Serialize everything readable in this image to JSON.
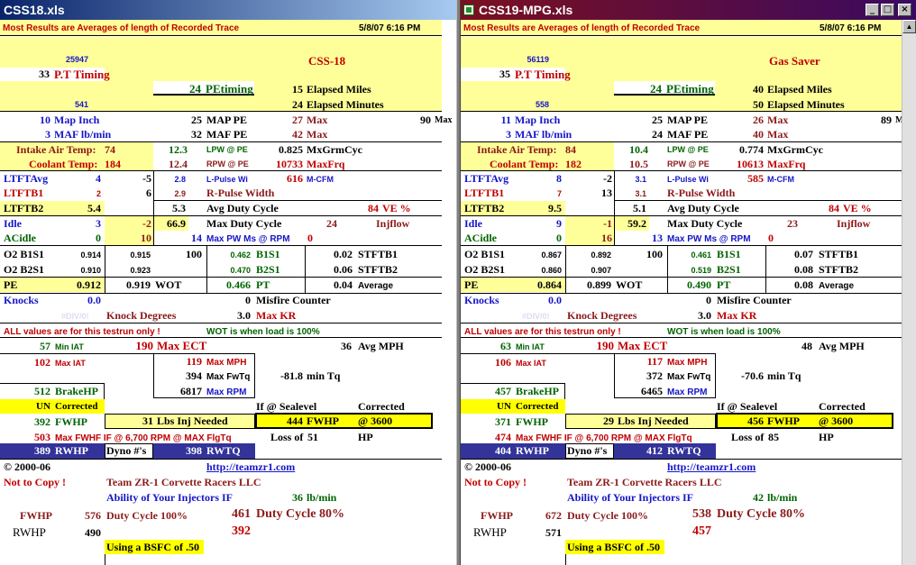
{
  "left": {
    "title": "CSS18.xls",
    "header": {
      "note": "Most Results are Averages of length of Recorded Trace",
      "date": "5/8/07 6:16 PM"
    },
    "top": {
      "v1": "25947",
      "pt_val": "33",
      "pt_label": "P.T Timing",
      "car_name": "CSS-18",
      "v2": "541",
      "petiming_val": "24",
      "petiming_label": "PEtiming",
      "miles_val": "15",
      "miles_label": "Elapsed Miles",
      "minutes_val": "24",
      "minutes_label": "Elapsed Minutes"
    },
    "map": {
      "map_inch_val": "10",
      "map_inch_label": "Map Inch",
      "map_pe_val": "25",
      "map_pe_label": "MAP PE",
      "max1_val": "27",
      "max1_label": "Max",
      "max_extra_val": "90",
      "max_extra_label": "Max",
      "maf_val": "3",
      "maf_label": "MAF lb/min",
      "maf_pe_val": "32",
      "maf_pe_label": "MAF PE",
      "max2_val": "42",
      "max2_label": "Max"
    },
    "temps": {
      "iat_label": "Intake Air Temp:",
      "iat_val": "74",
      "lpw_val": "12.3",
      "lpw_label": "LPW @ PE",
      "mxgrm_val": "0.825",
      "mxgrm_label": "MxGrmCyc",
      "ct_label": "Coolant Temp:",
      "ct_val": "184",
      "rpw_val": "12.4",
      "rpw_label": "RPW @ PE",
      "maxfrq_val": "10733",
      "maxfrq_label": "MaxFrq"
    },
    "fuel": {
      "ltftavg_label": "LTFTAvg",
      "ltftavg_v1": "4",
      "ltftavg_v2": "-5",
      "lpulse_val": "2.8",
      "lpulse_label": "L-Pulse Wi",
      "mcfm_val": "616",
      "mcfm_label": "M-CFM",
      "ltftb1_label": "LTFTB1",
      "ltftb1_v1": "2",
      "ltftb1_v2": "6",
      "rpulse_val": "2.9",
      "rpulse_label": "R-Pulse Width",
      "ltftb2_label": "LTFTB2",
      "ltftb2_val": "5.4",
      "avgdc_val": "5.3",
      "avgdc_label": "Avg Duty Cycle",
      "ve_val": "84",
      "ve_label": "VE %",
      "idle_label": "Idle",
      "idle_v1": "3",
      "idle_v2": "-2",
      "maxdc_val": "66.9",
      "maxdc_label": "Max Duty Cycle",
      "injflow_val": "24",
      "injflow_label": "Injflow",
      "acidle_label": "ACidle",
      "acidle_v1": "0",
      "acidle_v2": "10",
      "maxpw_val": "14",
      "maxpw_label": "Max PW Ms @ RPM",
      "maxpw_rpm": "0"
    },
    "o2": {
      "b1_label": "O2 B1S1",
      "b1_v1": "0.914",
      "b1_v2": "0.915",
      "b1_v3": "100",
      "b1_v4": "0.462",
      "b1_mid": "B1S1",
      "b1_v5": "0.02",
      "b1_right": "STFTB1",
      "b2_label": "O2 B2S1",
      "b2_v1": "0.910",
      "b2_v2": "0.923",
      "b2_v4": "0.470",
      "b2_mid": "B2S1",
      "b2_v5": "0.06",
      "b2_right": "STFTB2",
      "pe_label": "PE",
      "pe_val": "0.912",
      "wot_val": "0.919",
      "wot_label": "WOT",
      "pt_val": "0.466",
      "pt_label": "PT",
      "avg_val": "0.04",
      "avg_label": "Average"
    },
    "knock": {
      "knocks_label": "Knocks",
      "knocks_val": "0.0",
      "misfire_val": "0",
      "misfire_label": "Misfire Counter",
      "div0": "#DIV/0!",
      "kd_label": "Knock Degrees",
      "maxkr_val": "3.0",
      "maxkr_label": "Max KR"
    },
    "notes": {
      "all_values": "ALL values are for this testrun only !",
      "wot_note": "WOT is when load is 100%"
    },
    "perf": {
      "miniat_val": "57",
      "miniat_label": "Min IAT",
      "maxect_val": "190",
      "maxect_label": "Max ECT",
      "avgmph_val": "36",
      "avgmph_label": "Avg MPH",
      "maxiat_val": "102",
      "maxiat_label": "Max IAT",
      "maxmph_val": "119",
      "maxmph_label": "Max MPH",
      "maxfwtq_val": "394",
      "maxfwtq_label": "Max FwTq",
      "mintq_val": "-81.8",
      "mintq_label": "min Tq",
      "maxrpm_val": "6817",
      "maxrpm_label": "Max RPM"
    },
    "hp": {
      "brake_val": "512",
      "brake_label": "BrakeHP",
      "un_label": "UN",
      "corrected_label": "Corrected",
      "if_sealevel": "If @ Sealevel",
      "corrected2": "Corrected",
      "fwhp_val": "392",
      "fwhp_label": "FWHP",
      "lbs_val": "31",
      "lbs_label": "Lbs Inj Needed",
      "fwhp2_val": "444",
      "fwhp2_label": "FWHP",
      "at3600": "@ 3600",
      "maxfwhf_val": "503",
      "maxfwhf_label": "Max FWHF IF @ 6,700 RPM @ MAX FlgTq",
      "loss_label": "Loss of",
      "loss_val": "51",
      "hp_label": "HP",
      "rwhp_val": "389",
      "rwhp_label": "RWHP",
      "dyno_label": "Dyno #'s",
      "rwtq_val": "398",
      "rwtq_label": "RWTQ"
    },
    "footer": {
      "copyright": "© 2000-06",
      "url": "http://teamzr1.com",
      "notcopy": "Not to Copy !",
      "team": "Team ZR-1 Corvette Racers LLC",
      "ability": "Ability of Your Injectors IF",
      "inj_val": "36",
      "inj_unit": "lb/min",
      "fwhp_label": "FWHP",
      "dc100_val": "576",
      "dc100_label": "Duty Cycle 100%",
      "dc80_val": "461",
      "dc80_label": "Duty Cycle 80%",
      "rwhp_label": "RWHP",
      "rwhp100": "490",
      "rwhp80": "392",
      "bsfc": "Using a BSFC of .50"
    }
  },
  "right": {
    "title": "CSS19-MPG.xls",
    "window_buttons": {
      "minimize": "_",
      "maximize": "□",
      "close": "×"
    },
    "header": {
      "note": "Most Results are Averages of length of Recorded Trace",
      "date": "5/8/07 6:16 PM"
    },
    "top": {
      "v1": "56119",
      "pt_val": "35",
      "pt_label": "P.T Timing",
      "car_name": "Gas Saver",
      "v2": "558",
      "petiming_val": "24",
      "petiming_label": "PEtiming",
      "miles_val": "40",
      "miles_label": "Elapsed Miles",
      "minutes_val": "50",
      "minutes_label": "Elapsed Minutes"
    },
    "map": {
      "map_inch_val": "11",
      "map_inch_label": "Map Inch",
      "map_pe_val": "25",
      "map_pe_label": "MAP PE",
      "max1_val": "26",
      "max1_label": "Max",
      "max_extra_val": "89",
      "max_extra_label": "M",
      "maf_val": "3",
      "maf_label": "MAF lb/min",
      "maf_pe_val": "24",
      "maf_pe_label": "MAF PE",
      "max2_val": "40",
      "max2_label": "Max"
    },
    "temps": {
      "iat_label": "Intake Air Temp:",
      "iat_val": "84",
      "lpw_val": "10.4",
      "lpw_label": "LPW @ PE",
      "mxgrm_val": "0.774",
      "mxgrm_label": "MxGrmCyc",
      "ct_label": "Coolant Temp:",
      "ct_val": "182",
      "rpw_val": "10.5",
      "rpw_label": "RPW @ PE",
      "maxfrq_val": "10613",
      "maxfrq_label": "MaxFrq"
    },
    "fuel": {
      "ltftavg_label": "LTFTAvg",
      "ltftavg_v1": "8",
      "ltftavg_v2": "-2",
      "lpulse_val": "3.1",
      "lpulse_label": "L-Pulse Wi",
      "mcfm_val": "585",
      "mcfm_label": "M-CFM",
      "ltftb1_label": "LTFTB1",
      "ltftb1_v1": "7",
      "ltftb1_v2": "13",
      "rpulse_val": "3.1",
      "rpulse_label": "R-Pulse Width",
      "ltftb2_label": "LTFTB2",
      "ltftb2_val": "9.5",
      "avgdc_val": "5.1",
      "avgdc_label": "Avg Duty Cycle",
      "ve_val": "84",
      "ve_label": "VE %",
      "idle_label": "Idle",
      "idle_v1": "9",
      "idle_v2": "-1",
      "maxdc_val": "59.2",
      "maxdc_label": "Max Duty Cycle",
      "injflow_val": "23",
      "injflow_label": "Injflow",
      "acidle_label": "ACidle",
      "acidle_v1": "0",
      "acidle_v2": "16",
      "maxpw_val": "13",
      "maxpw_label": "Max PW Ms @ RPM",
      "maxpw_rpm": "0"
    },
    "o2": {
      "b1_label": "O2 B1S1",
      "b1_v1": "0.867",
      "b1_v2": "0.892",
      "b1_v3": "100",
      "b1_v4": "0.461",
      "b1_mid": "B1S1",
      "b1_v5": "0.07",
      "b1_right": "STFTB1",
      "b2_label": "O2 B2S1",
      "b2_v1": "0.860",
      "b2_v2": "0.907",
      "b2_v4": "0.519",
      "b2_mid": "B2S1",
      "b2_v5": "0.08",
      "b2_right": "STFTB2",
      "pe_label": "PE",
      "pe_val": "0.864",
      "wot_val": "0.899",
      "wot_label": "WOT",
      "pt_val": "0.490",
      "pt_label": "PT",
      "avg_val": "0.08",
      "avg_label": "Average"
    },
    "knock": {
      "knocks_label": "Knocks",
      "knocks_val": "0.0",
      "misfire_val": "0",
      "misfire_label": "Misfire Counter",
      "div0": "#DIV/0!",
      "kd_label": "Knock Degrees",
      "maxkr_val": "3.0",
      "maxkr_label": "Max KR"
    },
    "notes": {
      "all_values": "ALL values are for this testrun only !",
      "wot_note": "WOT is when load is 100%"
    },
    "perf": {
      "miniat_val": "63",
      "miniat_label": "Min IAT",
      "maxect_val": "190",
      "maxect_label": "Max ECT",
      "avgmph_val": "48",
      "avgmph_label": "Avg MPH",
      "maxiat_val": "106",
      "maxiat_label": "Max IAT",
      "maxmph_val": "117",
      "maxmph_label": "Max MPH",
      "maxfwtq_val": "372",
      "maxfwtq_label": "Max FwTq",
      "mintq_val": "-70.6",
      "mintq_label": "min Tq",
      "maxrpm_val": "6465",
      "maxrpm_label": "Max RPM"
    },
    "hp": {
      "brake_val": "457",
      "brake_label": "BrakeHP",
      "un_label": "UN",
      "corrected_label": "Corrected",
      "if_sealevel": "If @ Sealevel",
      "corrected2": "Corrected",
      "fwhp_val": "371",
      "fwhp_label": "FWHP",
      "lbs_val": "29",
      "lbs_label": "Lbs Inj Needed",
      "fwhp2_val": "456",
      "fwhp2_label": "FWHP",
      "at3600": "@ 3600",
      "maxfwhf_val": "474",
      "maxfwhf_label": "Max FWHF IF @ 6,700 RPM @ MAX FlgTq",
      "loss_label": "Loss of",
      "loss_val": "85",
      "hp_label": "HP",
      "rwhp_val": "404",
      "rwhp_label": "RWHP",
      "dyno_label": "Dyno #'s",
      "rwtq_val": "412",
      "rwtq_label": "RWTQ"
    },
    "footer": {
      "copyright": "© 2000-06",
      "url": "http://teamzr1.com",
      "notcopy": "Not to Copy !",
      "team": "Team ZR-1 Corvette Racers LLC",
      "ability": "Ability of Your Injectors IF",
      "inj_val": "42",
      "inj_unit": "lb/min",
      "fwhp_label": "FWHP",
      "dc100_val": "672",
      "dc100_label": "Duty Cycle 100%",
      "dc80_val": "538",
      "dc80_label": "Duty Cycle 80%",
      "rwhp_label": "RWHP",
      "rwhp100": "571",
      "rwhp80": "457",
      "bsfc": "Using a BSFC of .50"
    }
  },
  "colors": {
    "yellow_fill": "#ffff99",
    "bright_yellow": "#ffff00",
    "navy_fill": "#33339a",
    "red_text": "#c00000",
    "blue_text": "#1616c8",
    "green_text": "#006400"
  }
}
